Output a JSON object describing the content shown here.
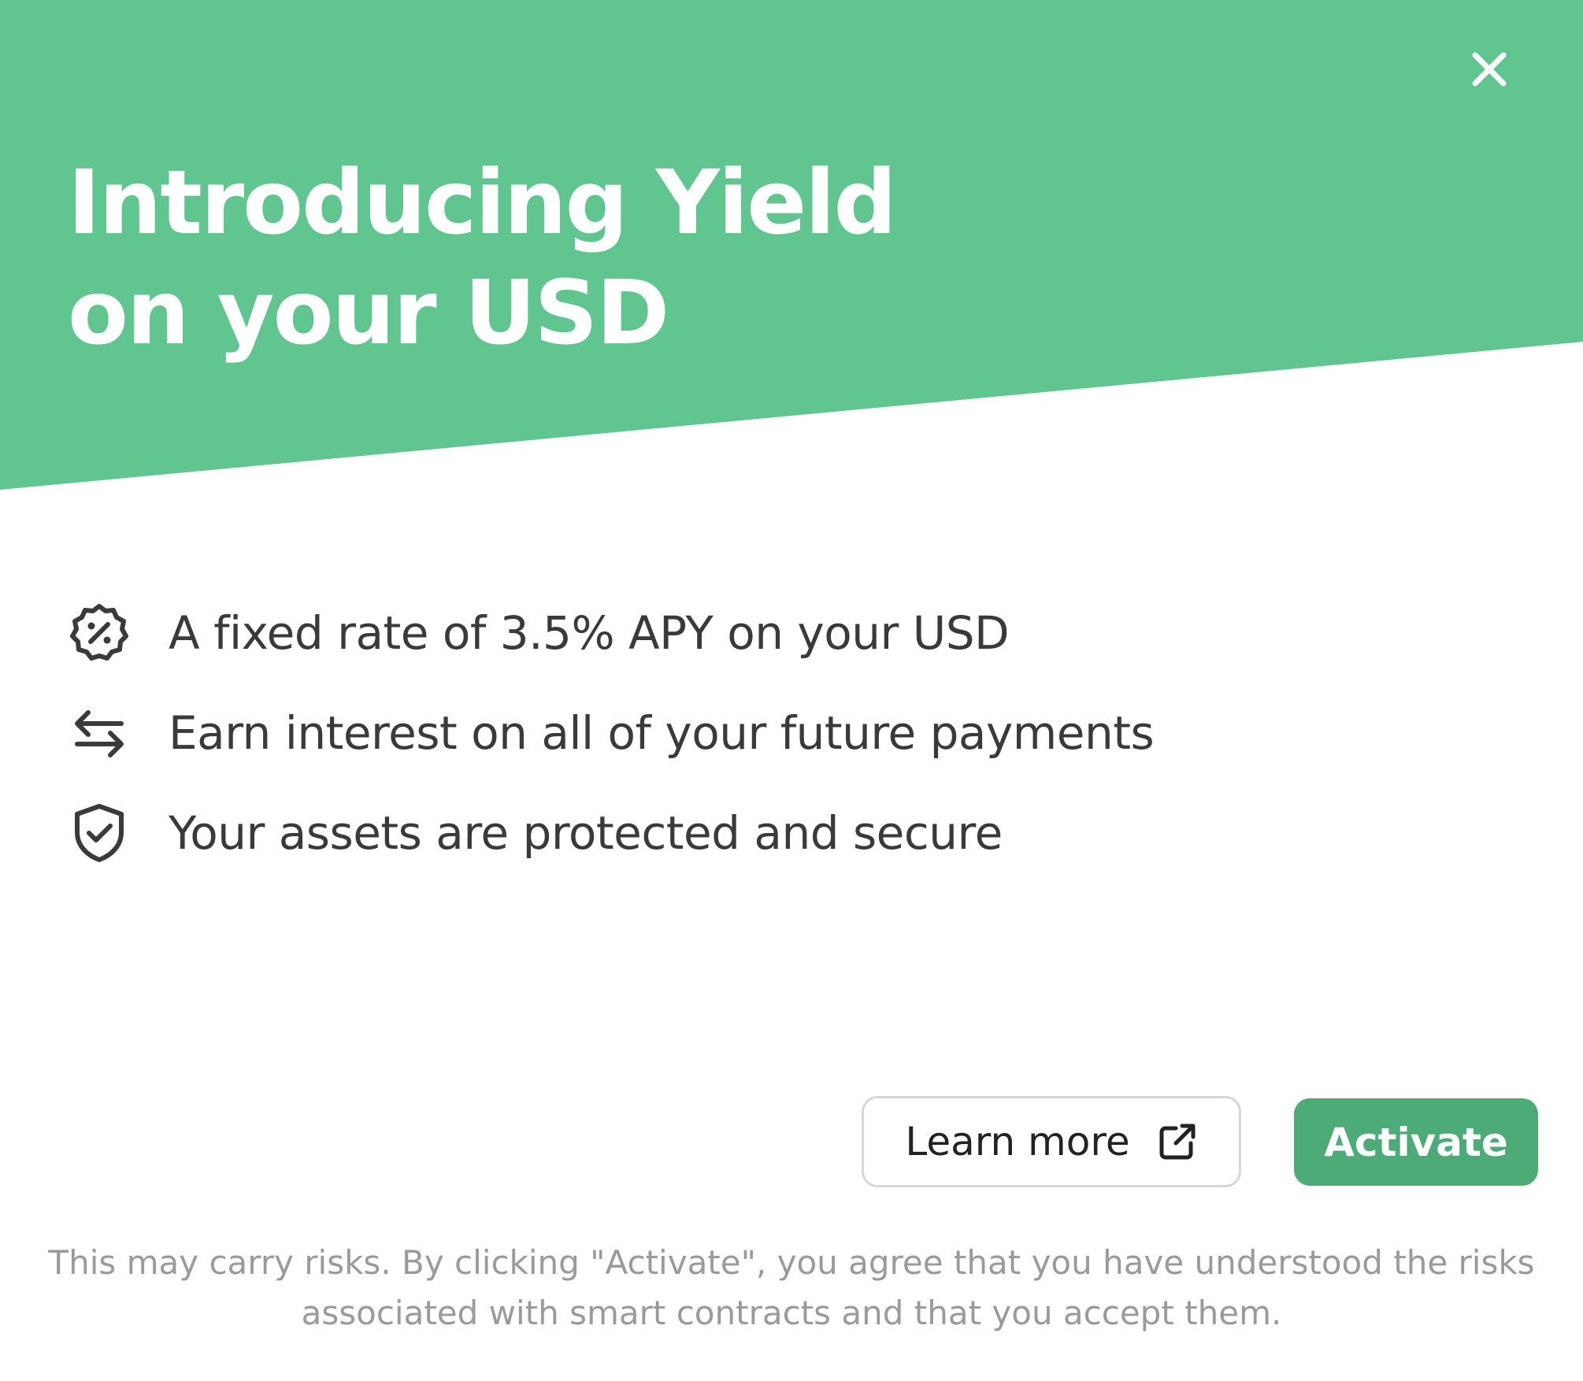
{
  "modal": {
    "close_icon": "close-icon",
    "title_line1": "Introducing Yield",
    "title_line2": "on your USD",
    "colors": {
      "hero": "#61c58f",
      "primary_button": "#4dab77",
      "text": "#3a3a3a",
      "muted_text": "#9a9a9a"
    }
  },
  "features": [
    {
      "icon": "percent-badge-icon",
      "text": "A fixed rate of 3.5% APY on your USD"
    },
    {
      "icon": "transfer-arrows-icon",
      "text": "Earn interest on all of your future payments"
    },
    {
      "icon": "shield-check-icon",
      "text": "Your assets are protected and secure"
    }
  ],
  "actions": {
    "learn_more_label": "Learn more",
    "learn_more_icon": "external-link-icon",
    "activate_label": "Activate"
  },
  "disclaimer": "This may carry risks. By clicking \"Activate\", you agree that you have understood the risks associated with smart contracts and that you accept them."
}
